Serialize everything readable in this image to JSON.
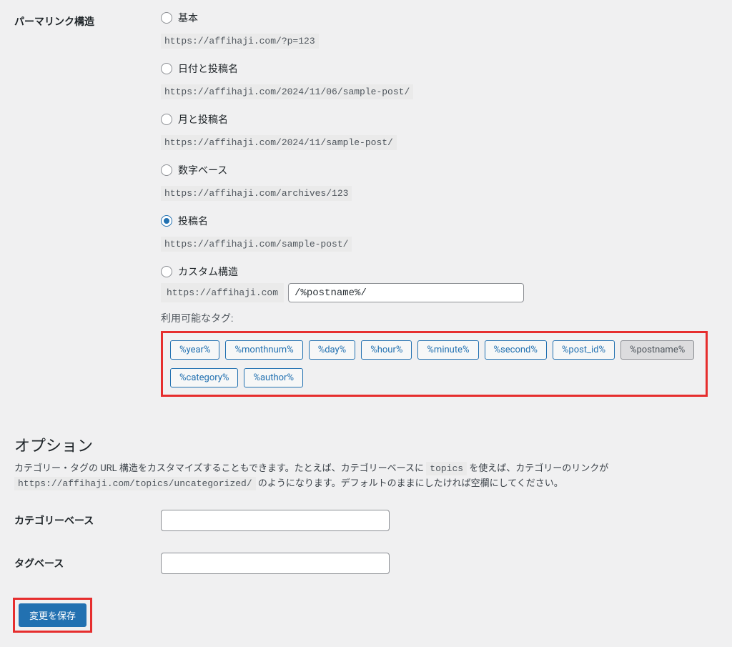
{
  "permalink": {
    "heading": "パーマリンク構造",
    "options": {
      "plain": {
        "label": "基本",
        "example": "https://affihaji.com/?p=123"
      },
      "date_name": {
        "label": "日付と投稿名",
        "example": "https://affihaji.com/2024/11/06/sample-post/"
      },
      "month_name": {
        "label": "月と投稿名",
        "example": "https://affihaji.com/2024/11/sample-post/"
      },
      "numeric": {
        "label": "数字ベース",
        "example": "https://affihaji.com/archives/123"
      },
      "post_name": {
        "label": "投稿名",
        "example": "https://affihaji.com/sample-post/"
      },
      "custom": {
        "label": "カスタム構造",
        "prefix": "https://affihaji.com",
        "value": "/%postname%/"
      }
    },
    "tags_label": "利用可能なタグ:",
    "tags": [
      "%year%",
      "%monthnum%",
      "%day%",
      "%hour%",
      "%minute%",
      "%second%",
      "%post_id%",
      "%postname%",
      "%category%",
      "%author%"
    ],
    "active_tag": "%postname%"
  },
  "optional": {
    "heading": "オプション",
    "desc_pre": "カテゴリー・タグの URL 構造をカスタマイズすることもできます。たとえば、カテゴリーベースに ",
    "desc_code1": "topics",
    "desc_mid": " を使えば、カテゴリーのリンクが ",
    "desc_code2": "https://affihaji.com/topics/uncategorized/",
    "desc_post": " のようになります。デフォルトのままにしたければ空欄にしてください。",
    "category_base_label": "カテゴリーベース",
    "category_base_value": "",
    "tag_base_label": "タグベース",
    "tag_base_value": ""
  },
  "submit": {
    "label": "変更を保存"
  }
}
